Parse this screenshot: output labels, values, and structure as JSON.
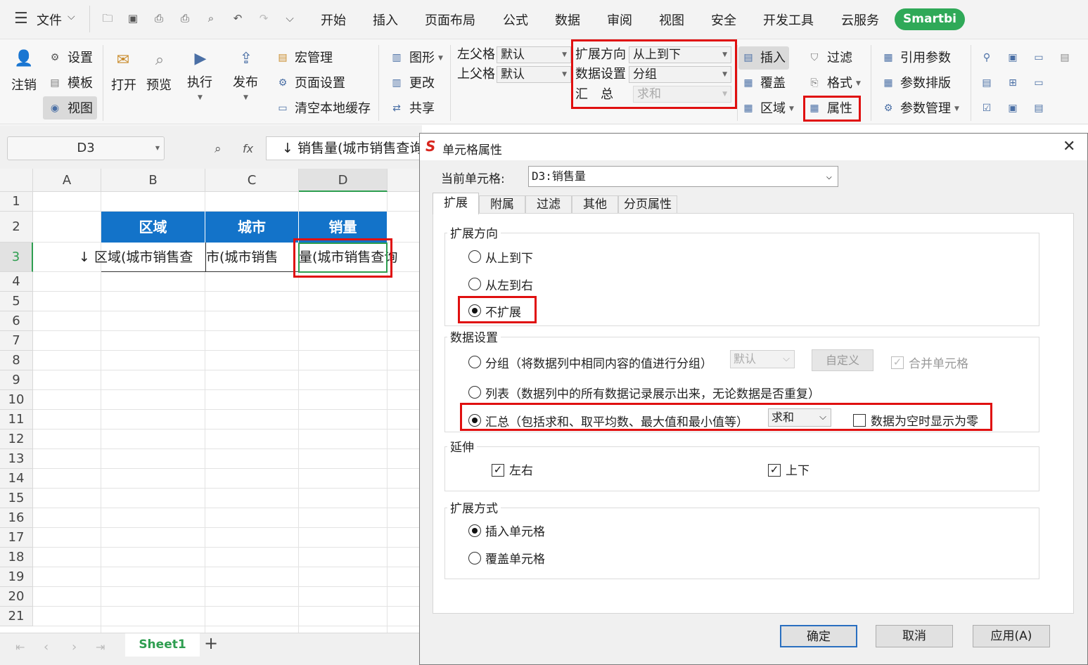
{
  "app": {
    "file_menu": "文件",
    "menu_tabs": [
      "开始",
      "插入",
      "页面布局",
      "公式",
      "数据",
      "审阅",
      "视图",
      "安全",
      "开发工具",
      "云服务"
    ],
    "smartbi_tab": "Smartbi"
  },
  "ribbon": {
    "logout": "注销",
    "settings": "设置",
    "template": "模板",
    "view": "视图",
    "open": "打开",
    "preview": "预览",
    "execute": "执行",
    "publish": "发布",
    "macro_manage": "宏管理",
    "page_setup": "页面设置",
    "clear_cache": "清空本地缓存",
    "chart": "图形",
    "change": "更改",
    "share": "共享",
    "left_parent_label": "左父格",
    "left_parent_value": "默认",
    "top_parent_label": "上父格",
    "top_parent_value": "默认",
    "expand_dir_label": "扩展方向",
    "expand_dir_value": "从上到下",
    "data_setting_label": "数据设置",
    "data_setting_value": "分组",
    "summary_label": "汇　总",
    "summary_value": "求和",
    "insert": "插入",
    "overwrite": "覆盖",
    "area": "区域",
    "filter": "过滤",
    "format": "格式",
    "property": "属性",
    "ref_param": "引用参数",
    "param_layout": "参数排版",
    "param_manage": "参数管理"
  },
  "formula_bar": {
    "cell_ref": "D3",
    "fx": "fx",
    "content": "↓ 销售量(城市销售查询"
  },
  "sheet": {
    "columns": [
      "A",
      "B",
      "C",
      "D"
    ],
    "rows": [
      "1",
      "2",
      "3",
      "4",
      "5",
      "6",
      "7",
      "8",
      "9",
      "10",
      "11",
      "12",
      "13",
      "14",
      "15",
      "16",
      "17",
      "18",
      "19",
      "20",
      "21"
    ],
    "header_cells": [
      "区域",
      "城市",
      "销量"
    ],
    "b3": "↓ 区域(城市销售查",
    "c3": "市(城市销售",
    "d3": "量(城市销售查询",
    "tab_name": "Sheet1",
    "add_tab": "+"
  },
  "dialog": {
    "title": "单元格属性",
    "current_cell_label": "当前单元格:",
    "current_cell_value": "D3:销售量",
    "tabs": [
      "扩展",
      "附属",
      "过滤",
      "其他",
      "分页属性"
    ],
    "expand_dir_title": "扩展方向",
    "dir_options": [
      "从上到下",
      "从左到右",
      "不扩展"
    ],
    "data_setting_title": "数据设置",
    "group_option": "分组（将数据列中相同内容的值进行分组）",
    "group_select": "默认",
    "custom_btn": "自定义",
    "merge_cells": "合并单元格",
    "list_option": "列表（数据列中的所有数据记录展示出来，无论数据是否重复）",
    "summary_option": "汇总（包括求和、取平均数、最大值和最小值等）",
    "summary_select": "求和",
    "empty_zero": "数据为空时显示为零",
    "extend_title": "延伸",
    "extend_lr": "左右",
    "extend_ud": "上下",
    "expand_mode_title": "扩展方式",
    "mode_options": [
      "插入单元格",
      "覆盖单元格"
    ],
    "ok": "确定",
    "cancel": "取消",
    "apply": "应用(A)"
  }
}
